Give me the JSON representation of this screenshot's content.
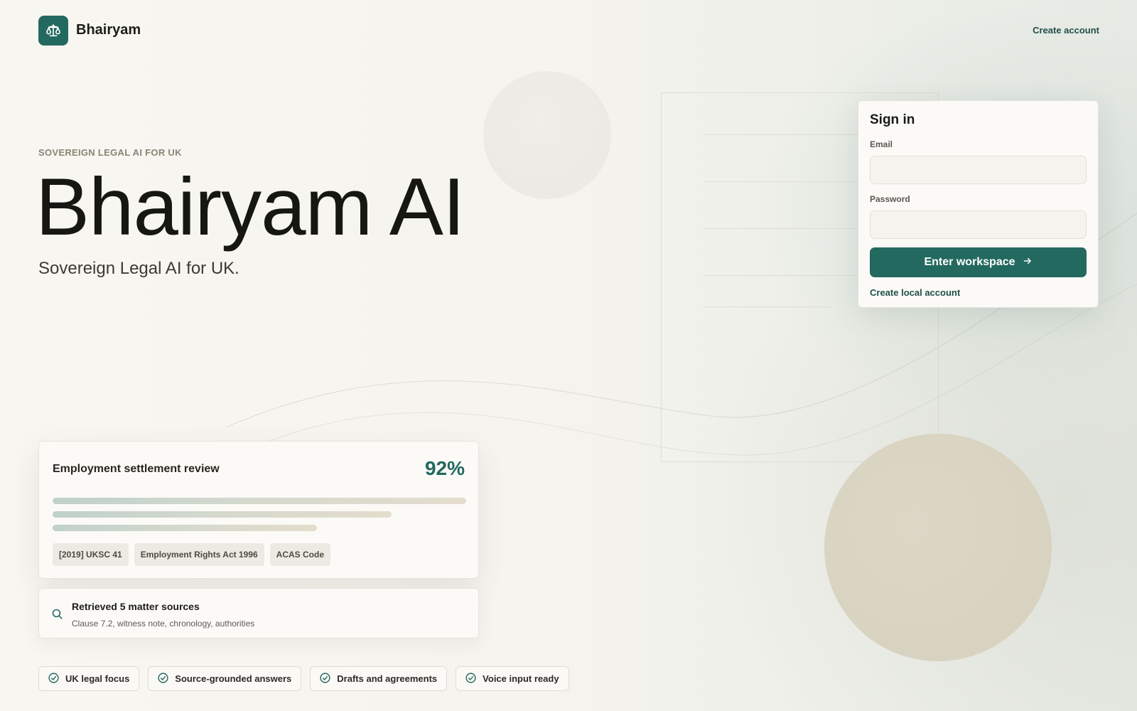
{
  "header": {
    "brand": "Bhairyam",
    "create_account": "Create account"
  },
  "hero": {
    "eyebrow": "SOVEREIGN LEGAL AI FOR UK",
    "title": "Bhairyam AI",
    "subtitle": "Sovereign Legal AI for UK."
  },
  "signin": {
    "title": "Sign in",
    "email_label": "Email",
    "email_value": "",
    "password_label": "Password",
    "password_value": "",
    "submit_label": "Enter workspace",
    "local_account_link": "Create local account"
  },
  "review": {
    "title": "Employment settlement review",
    "score": "92%",
    "chips": [
      "[2019] UKSC 41",
      "Employment Rights Act 1996",
      "ACAS Code"
    ]
  },
  "sources": {
    "title": "Retrieved 5 matter sources",
    "detail": "Clause 7.2, witness note, chronology, authorities"
  },
  "features": [
    "UK legal focus",
    "Source-grounded answers",
    "Drafts and agreements",
    "Voice input ready"
  ],
  "colors": {
    "accent": "#23695f",
    "background": "#f6f4ee",
    "card": "#fbfaf7"
  },
  "icons": {
    "logo": "scales-icon",
    "sources": "search-icon",
    "feature": "check-circle-icon",
    "submit": "arrow-right-icon"
  }
}
